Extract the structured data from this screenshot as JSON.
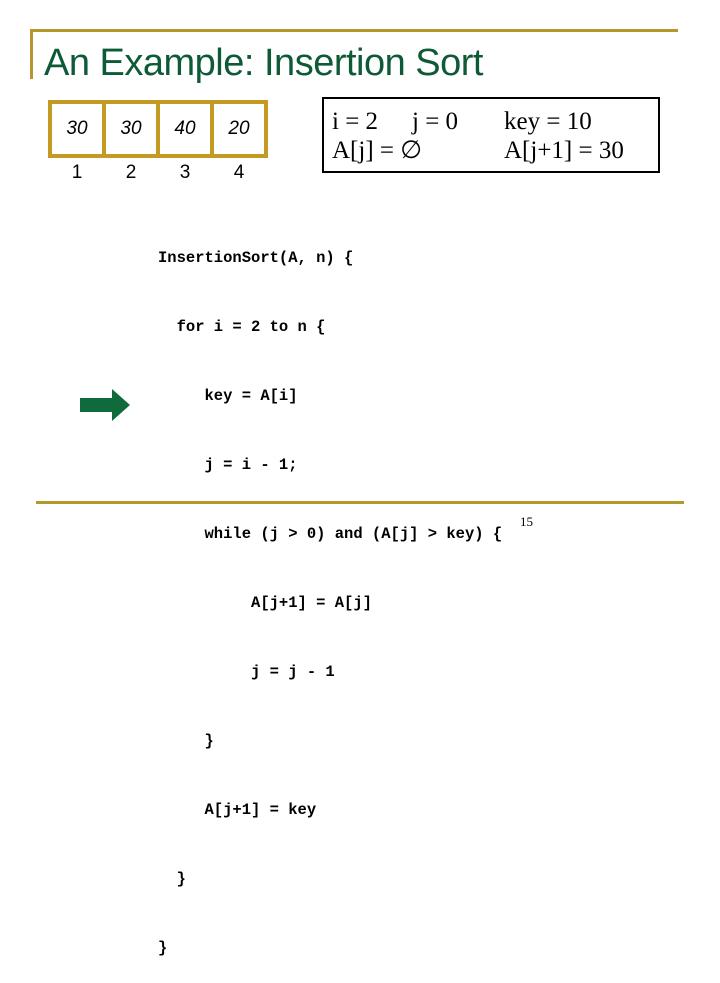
{
  "slide": {
    "title": "An Example: Insertion Sort",
    "page_number": "15"
  },
  "array": {
    "values": [
      "30",
      "30",
      "40",
      "20"
    ],
    "indices": [
      "1",
      "2",
      "3",
      "4"
    ]
  },
  "variables": {
    "i": "i = 2",
    "j": "j = 0",
    "key": "key = 10",
    "a_j": "A[j] = ∅",
    "a_j1": "A[j+1] = 30"
  },
  "code": {
    "lines": [
      "InsertionSort(A, n) {",
      "  for i = 2 to n {",
      "     key = A[i]",
      "     j = i - 1;",
      "     while (j > 0) and (A[j] > key) {",
      "          A[j+1] = A[j]",
      "          j = j - 1",
      "     }",
      "     A[j+1] = key",
      "  }",
      "}"
    ],
    "current_line_index": 8
  },
  "colors": {
    "title": "#0f5a36",
    "accent_rule": "#b8962e",
    "array_border": "#c49a22",
    "arrow": "#0f6b3c"
  },
  "icons": {
    "pointer": "right-arrow-icon"
  }
}
